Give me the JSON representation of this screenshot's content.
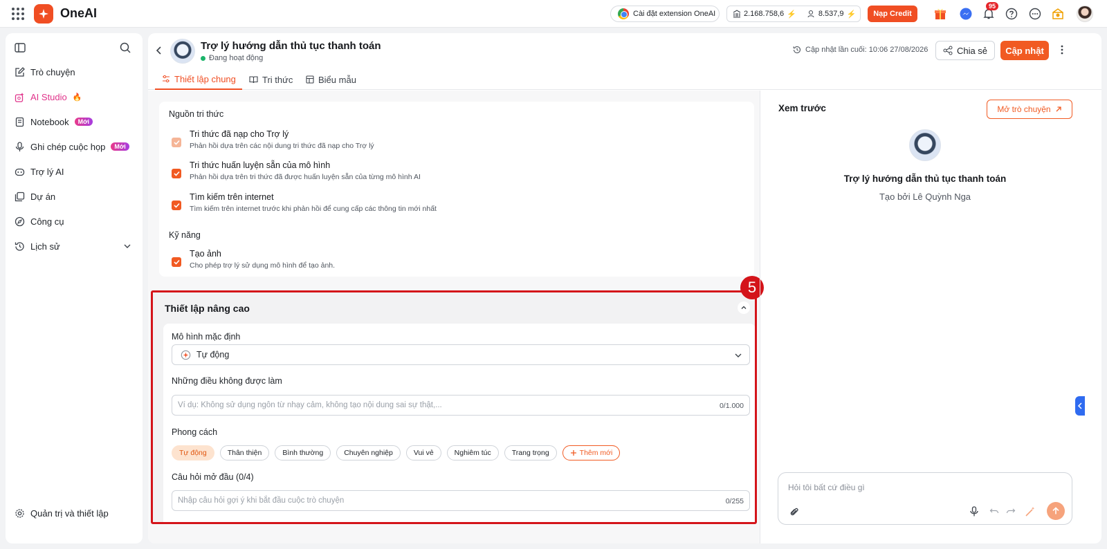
{
  "topbar": {
    "brand": "OneAI",
    "extension_label": "Cài đặt extension OneAI",
    "credit_1": "2.168.758,6",
    "credit_2": "8.537,9",
    "topup_label": "Nạp Credit",
    "notifications_count": "95"
  },
  "sidebar": {
    "items": [
      {
        "label": "Trò chuyện",
        "icon": "chat-edit-icon"
      },
      {
        "label": "AI Studio",
        "icon": "ai-studio-icon"
      },
      {
        "label": "Notebook",
        "icon": "notebook-icon",
        "badge": "Mới"
      },
      {
        "label": "Ghi chép cuộc họp",
        "icon": "mic-icon",
        "badge": "Mới"
      },
      {
        "label": "Trợ lý AI",
        "icon": "robot-icon"
      },
      {
        "label": "Dự án",
        "icon": "project-icon"
      },
      {
        "label": "Công cụ",
        "icon": "compass-icon"
      },
      {
        "label": "Lịch sử",
        "icon": "history-icon"
      }
    ],
    "footer_label": "Quản trị và thiết lập"
  },
  "header": {
    "title": "Trợ lý hướng dẫn thủ tục thanh toán",
    "status": "Đang hoạt động",
    "last_updated": "Cập nhật lần cuối: 10:06 27/08/2026",
    "share_label": "Chia sẻ",
    "update_label": "Cập nhật"
  },
  "tabs": [
    {
      "label": "Thiết lập chung",
      "active": true
    },
    {
      "label": "Tri thức",
      "active": false
    },
    {
      "label": "Biểu mẫu",
      "active": false
    }
  ],
  "knowledge": {
    "section_label": "Nguồn tri thức",
    "options": [
      {
        "title": "Tri thức đã nạp cho Trợ lý",
        "desc": "Phản hồi dựa trên các nội dung tri thức đã nạp cho Trợ lý",
        "checked": true
      },
      {
        "title": "Tri thức huấn luyện sẵn của mô hình",
        "desc": "Phản hồi dựa trên tri thức đã được huấn luyện sẵn của từng mô hình AI",
        "checked": true
      },
      {
        "title": "Tìm kiếm trên internet",
        "desc": "Tìm kiếm trên internet trước khi phản hồi để cung cấp các thông tin mới nhất",
        "checked": true
      }
    ],
    "skills_label": "Kỹ năng",
    "skill": {
      "title": "Tạo ảnh",
      "desc": "Cho phép trợ lý sử dụng mô hình để tạo ảnh.",
      "checked": true
    }
  },
  "advanced": {
    "title": "Thiết lập nâng cao",
    "marker": "5",
    "model_label": "Mô hình mặc định",
    "model_value": "Tự động",
    "restrictions_label": "Những điều không được làm",
    "restrictions_placeholder": "Ví dụ: Không sử dụng ngôn từ nhạy cảm, không tạo nội dung sai sự thật,...",
    "restrictions_count": "0/1.000",
    "style_label": "Phong cách",
    "styles": [
      "Tự động",
      "Thân thiện",
      "Bình thường",
      "Chuyên nghiệp",
      "Vui vẻ",
      "Nghiêm túc",
      "Trang trọng"
    ],
    "add_style_label": "Thêm mới",
    "opening_label": "Câu hỏi mở đầu (0/4)",
    "opening_placeholder": "Nhập câu hỏi gợi ý khi bắt đầu cuộc trò chuyện",
    "opening_count": "0/255"
  },
  "preview": {
    "title": "Xem trước",
    "open_chat_label": "Mở trò chuyện",
    "bot_name": "Trợ lý hướng dẫn thủ tục thanh toán",
    "created_by": "Tạo bởi Lê Quỳnh Nga",
    "composer_placeholder": "Hỏi tôi bất cứ điều gì"
  },
  "colors": {
    "accent": "#f15a22",
    "highlight_outline": "#d4141a",
    "studio_pink": "#e0338a"
  }
}
